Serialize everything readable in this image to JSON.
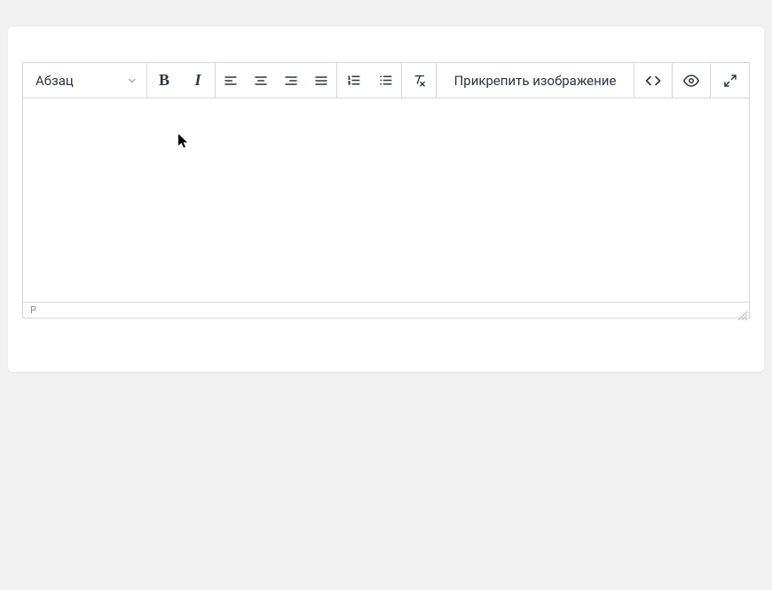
{
  "toolbar": {
    "format_label": "Абзац",
    "bold_label": "B",
    "italic_label": "I",
    "attach_label": "Прикрепить изображение"
  },
  "statusbar": {
    "path": "P"
  }
}
